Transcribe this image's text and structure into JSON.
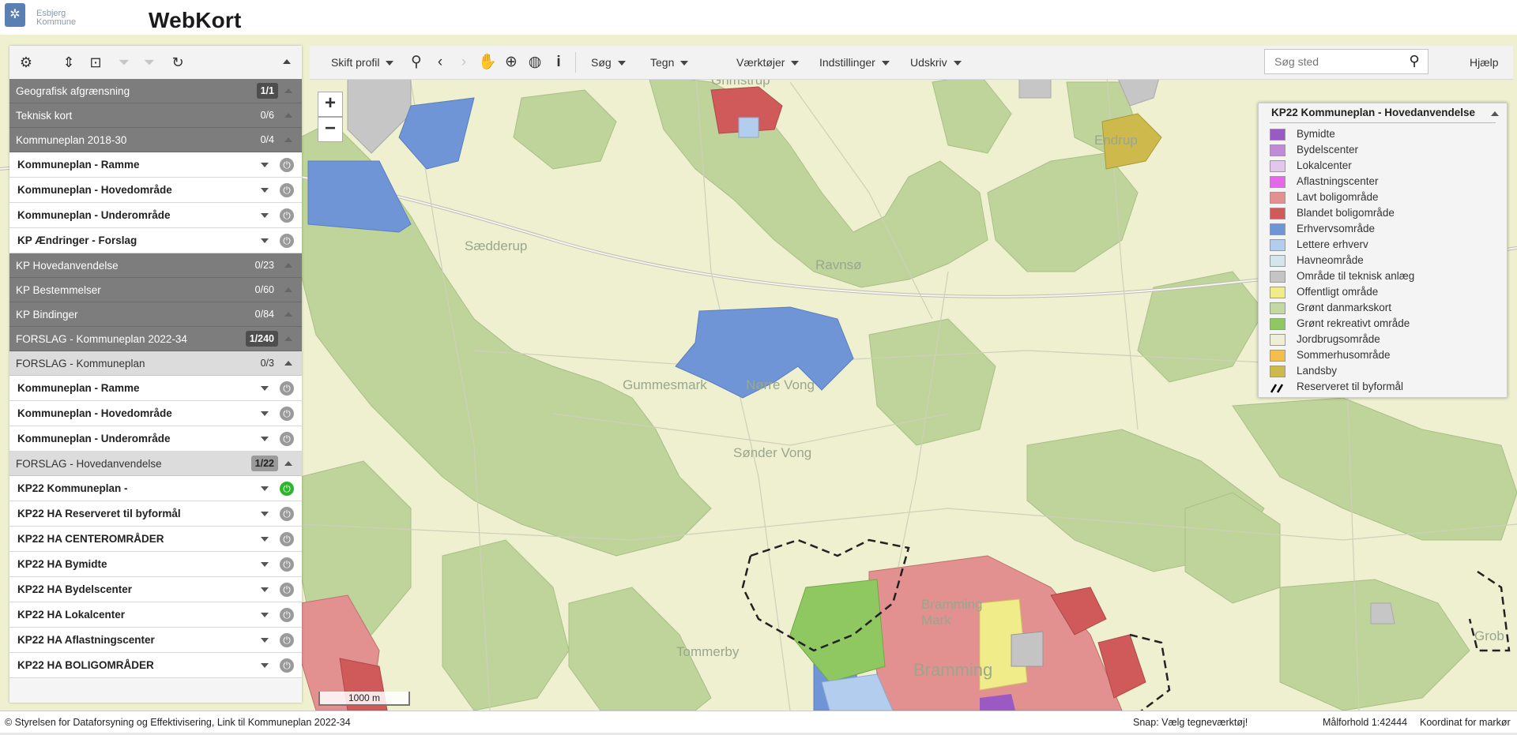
{
  "header": {
    "logo_line1": "Esbjerg",
    "logo_line2": "Kommune",
    "app_title": "WebKort"
  },
  "toolbar": {
    "skift_profil": "Skift profil",
    "menus": [
      "Søg",
      "Tegn",
      "Værktøjer",
      "Indstillinger",
      "Udskriv"
    ],
    "search_placeholder": "Søg sted",
    "help": "Hjælp"
  },
  "panel": {
    "rows": [
      {
        "type": "dark",
        "label": "Geografisk afgrænsning",
        "count": "1/1",
        "boxed": true
      },
      {
        "type": "dark",
        "label": "Teknisk kort",
        "count": "0/6",
        "boxed": false
      },
      {
        "type": "dark",
        "label": "Kommuneplan 2018-30",
        "count": "0/4",
        "boxed": false
      },
      {
        "type": "item",
        "label": "Kommuneplan - Ramme",
        "on": false
      },
      {
        "type": "item",
        "label": "Kommuneplan - Hovedområde",
        "on": false
      },
      {
        "type": "item",
        "label": "Kommuneplan - Underområde",
        "on": false
      },
      {
        "type": "item",
        "label": "KP Ændringer - Forslag",
        "on": false
      },
      {
        "type": "dark",
        "label": "KP Hovedanvendelse",
        "count": "0/23",
        "boxed": false
      },
      {
        "type": "dark",
        "label": "KP Bestemmelser",
        "count": "0/60",
        "boxed": false
      },
      {
        "type": "dark",
        "label": "KP Bindinger",
        "count": "0/84",
        "boxed": false
      },
      {
        "type": "dark",
        "label": "FORSLAG - Kommuneplan 2022-34",
        "count": "1/240",
        "boxed": true
      },
      {
        "type": "light",
        "label": "FORSLAG - Kommuneplan",
        "count": "0/3",
        "boxed": false
      },
      {
        "type": "item",
        "label": "Kommuneplan - Ramme",
        "on": false
      },
      {
        "type": "item",
        "label": "Kommuneplan - Hovedområde",
        "on": false
      },
      {
        "type": "item",
        "label": "Kommuneplan - Underområde",
        "on": false
      },
      {
        "type": "light",
        "label": "FORSLAG - Hovedanvendelse",
        "count": "1/22",
        "boxed": true
      },
      {
        "type": "item",
        "label": "KP22 Kommuneplan -",
        "on": true
      },
      {
        "type": "item",
        "label": "KP22 HA Reserveret til byformål",
        "on": false
      },
      {
        "type": "item",
        "label": "KP22 HA CENTEROMRÅDER",
        "on": false
      },
      {
        "type": "item",
        "label": "KP22 HA Bymidte",
        "on": false
      },
      {
        "type": "item",
        "label": "KP22 HA Bydelscenter",
        "on": false
      },
      {
        "type": "item",
        "label": "KP22 HA Lokalcenter",
        "on": false
      },
      {
        "type": "item",
        "label": "KP22 HA Aflastningscenter",
        "on": false
      },
      {
        "type": "item",
        "label": "KP22 HA BOLIGOMRÅDER",
        "on": false
      }
    ]
  },
  "legend": {
    "title": "KP22 Kommuneplan - Hovedanvendelse",
    "items": [
      {
        "label": "Bymidte",
        "color": "#9b59c4"
      },
      {
        "label": "Bydelscenter",
        "color": "#c08ad8"
      },
      {
        "label": "Lokalcenter",
        "color": "#e2c6ec"
      },
      {
        "label": "Aflastningscenter",
        "color": "#e468e8"
      },
      {
        "label": "Lavt boligområde",
        "color": "#e29090"
      },
      {
        "label": "Blandet boligområde",
        "color": "#d05a5a"
      },
      {
        "label": "Erhvervsområde",
        "color": "#6f95d6"
      },
      {
        "label": "Lettere erhverv",
        "color": "#b3cdee"
      },
      {
        "label": "Havneområde",
        "color": "#d4e6ec"
      },
      {
        "label": "Område til teknisk anlæg",
        "color": "#c4c4c4"
      },
      {
        "label": "Offentligt område",
        "color": "#f0ec8a"
      },
      {
        "label": "Grønt danmarkskort",
        "color": "#c3d8a2"
      },
      {
        "label": "Grønt rekreativt område",
        "color": "#8fc860"
      },
      {
        "label": "Jordbrugsområde",
        "color": "#f0eed6"
      },
      {
        "label": "Sommerhusområde",
        "color": "#f2be4e"
      },
      {
        "label": "Landsby",
        "color": "#cdb94c"
      },
      {
        "label": "Reserveret til byformål",
        "color": "#000000"
      }
    ]
  },
  "map": {
    "places": [
      "Sædderup",
      "Ravnsø",
      "Grimstrup",
      "Endrup",
      "Gummesmark",
      "Nørre Vong",
      "Sønder Vong",
      "Tommerby",
      "Bramming",
      "Bramming Mark",
      "Grob"
    ],
    "scale_label": "1000 m"
  },
  "footer": {
    "copyright": "© Styrelsen for Dataforsyning og Effektivisering, Link til Kommuneplan 2022-34",
    "snap": "Snap: Vælg tegneværktøj!",
    "scale": "Målforhold 1:42444",
    "coord": "Koordinat for markør"
  }
}
